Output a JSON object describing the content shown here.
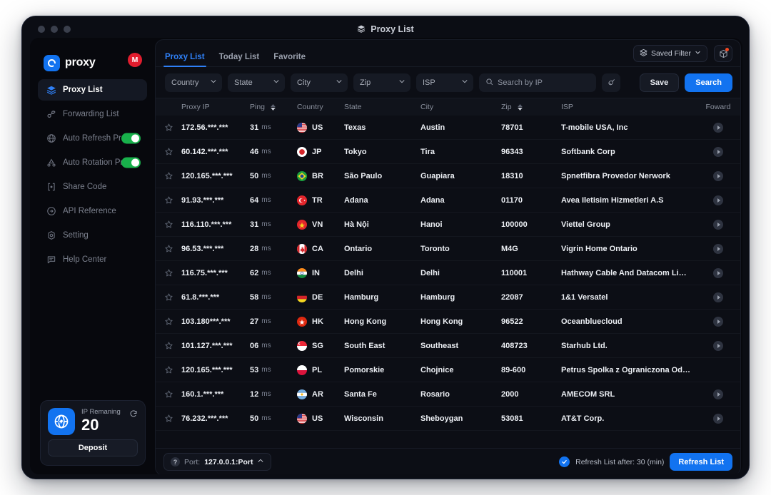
{
  "window": {
    "title": "Proxy List",
    "title_icon": "layers-icon"
  },
  "sidebar": {
    "brand": "proxy",
    "avatar_initial": "M",
    "items": [
      {
        "label": "Proxy List",
        "icon": "layers-icon",
        "active": true,
        "toggle": null
      },
      {
        "label": "Forwarding List",
        "icon": "link-icon",
        "active": false,
        "toggle": null
      },
      {
        "label": "Auto Refresh Proxy",
        "icon": "globe-icon",
        "active": false,
        "toggle": "on"
      },
      {
        "label": "Auto Rotation Proxy",
        "icon": "rotate-icon",
        "active": false,
        "toggle": "on"
      },
      {
        "label": "Share Code",
        "icon": "code-icon",
        "active": false,
        "toggle": null
      },
      {
        "label": "API Reference",
        "icon": "api-icon",
        "active": false,
        "toggle": null
      },
      {
        "label": "Setting",
        "icon": "gear-icon",
        "active": false,
        "toggle": null
      },
      {
        "label": "Help Center",
        "icon": "chat-icon",
        "active": false,
        "toggle": null
      }
    ],
    "ip_card": {
      "label": "IP Remaning",
      "count": "20",
      "deposit_label": "Deposit",
      "refresh_icon": "refresh-icon",
      "globe_icon": "globe-plane-icon"
    }
  },
  "tabs": [
    {
      "label": "Proxy List",
      "active": true
    },
    {
      "label": "Today List",
      "active": false
    },
    {
      "label": "Favorite",
      "active": false
    }
  ],
  "toolbar": {
    "saved_filter_label": "Saved Filter",
    "package_icon": "package-icon",
    "package_badge": true,
    "filters": [
      {
        "name": "country",
        "label": "Country"
      },
      {
        "name": "state",
        "label": "State"
      },
      {
        "name": "city",
        "label": "City"
      },
      {
        "name": "zip",
        "label": "Zip"
      },
      {
        "name": "isp",
        "label": "ISP"
      }
    ],
    "search_placeholder": "Search by IP",
    "search_value": "",
    "clear_icon": "broom-icon",
    "save_label": "Save",
    "search_label": "Search"
  },
  "table": {
    "columns": [
      {
        "key": "star",
        "label": "",
        "sort": false
      },
      {
        "key": "ip",
        "label": "Proxy IP",
        "sort": false
      },
      {
        "key": "ping",
        "label": "Ping",
        "sort": true
      },
      {
        "key": "country",
        "label": "Country",
        "sort": false
      },
      {
        "key": "state",
        "label": "State",
        "sort": false
      },
      {
        "key": "city",
        "label": "City",
        "sort": false
      },
      {
        "key": "zip",
        "label": "Zip",
        "sort": true
      },
      {
        "key": "isp",
        "label": "ISP",
        "sort": false
      },
      {
        "key": "fwd",
        "label": "Foward",
        "sort": false
      }
    ],
    "unit": "ms",
    "rows": [
      {
        "ip": "172.56.***.***",
        "ping": "31",
        "cc": "US",
        "flag": "us",
        "state": "Texas",
        "city": "Austin",
        "zip": "78701",
        "isp": "T-mobile USA, Inc",
        "fwd": true
      },
      {
        "ip": "60.142.***.***",
        "ping": "46",
        "cc": "JP",
        "flag": "jp",
        "state": "Tokyo",
        "city": "Tira",
        "zip": "96343",
        "isp": "Softbank Corp",
        "fwd": true
      },
      {
        "ip": "120.165.***.***",
        "ping": "50",
        "cc": "BR",
        "flag": "br",
        "state": "São Paulo",
        "city": "Guapiara",
        "zip": "18310",
        "isp": "Spnetfibra Provedor Nerwork",
        "fwd": true
      },
      {
        "ip": "91.93.***.***",
        "ping": "64",
        "cc": "TR",
        "flag": "tr",
        "state": "Adana",
        "city": "Adana",
        "zip": "01170",
        "isp": "Avea Iletisim Hizmetleri A.S",
        "fwd": true
      },
      {
        "ip": "116.110.***.***",
        "ping": "31",
        "cc": "VN",
        "flag": "vn",
        "state": "Hà Nội",
        "city": "Hanoi",
        "zip": "100000",
        "isp": "Viettel Group",
        "fwd": true
      },
      {
        "ip": "96.53.***.***",
        "ping": "28",
        "cc": "CA",
        "flag": "ca",
        "state": "Ontario",
        "city": "Toronto",
        "zip": "M4G",
        "isp": "Vigrin Home Ontario",
        "fwd": true
      },
      {
        "ip": "116.75.***.***",
        "ping": "62",
        "cc": "IN",
        "flag": "in",
        "state": "Delhi",
        "city": "Delhi",
        "zip": "110001",
        "isp": "Hathway Cable And Datacom Limited",
        "fwd": true
      },
      {
        "ip": "61.8.***.***",
        "ping": "58",
        "cc": "DE",
        "flag": "de",
        "state": "Hamburg",
        "city": "Hamburg",
        "zip": "22087",
        "isp": "1&1 Versatel",
        "fwd": true
      },
      {
        "ip": "103.180***.***",
        "ping": "27",
        "cc": "HK",
        "flag": "hk",
        "state": "Hong Kong",
        "city": "Hong Kong",
        "zip": "96522",
        "isp": "Oceanbluecloud",
        "fwd": true
      },
      {
        "ip": "101.127.***.***",
        "ping": "06",
        "cc": "SG",
        "flag": "sg",
        "state": "South East",
        "city": "Southeast",
        "zip": "408723",
        "isp": "Starhub Ltd.",
        "fwd": true
      },
      {
        "ip": "120.165.***.***",
        "ping": "53",
        "cc": "PL",
        "flag": "pl",
        "state": "Pomorskie",
        "city": "Chojnice",
        "zip": "89-600",
        "isp": "Petrus Spolka z Ograniczona Odpowied...",
        "fwd": false
      },
      {
        "ip": "160.1.***.***",
        "ping": "12",
        "cc": "AR",
        "flag": "ar",
        "state": "Santa Fe",
        "city": "Rosario",
        "zip": "2000",
        "isp": "AMECOM SRL",
        "fwd": true
      },
      {
        "ip": "76.232.***.***",
        "ping": "50",
        "cc": "US",
        "flag": "us",
        "state": "Wisconsin",
        "city": "Sheboygan",
        "zip": "53081",
        "isp": "AT&T Corp.",
        "fwd": true
      }
    ]
  },
  "bottom": {
    "port_prefix": "Port:",
    "port_value": "127.0.0.1:Port",
    "help_icon": "question-icon",
    "chevron": "chevron-up-icon",
    "refresh_checkbox_checked": true,
    "refresh_label": "Refresh List after: 30 (min)",
    "refresh_button": "Refresh List"
  },
  "colors": {
    "accent": "#1273f0",
    "toggle_on": "#18b14b",
    "avatar": "#e11d2e",
    "badge": "#f24822",
    "panel": "#0c0e15",
    "app_bg": "#07080d"
  }
}
